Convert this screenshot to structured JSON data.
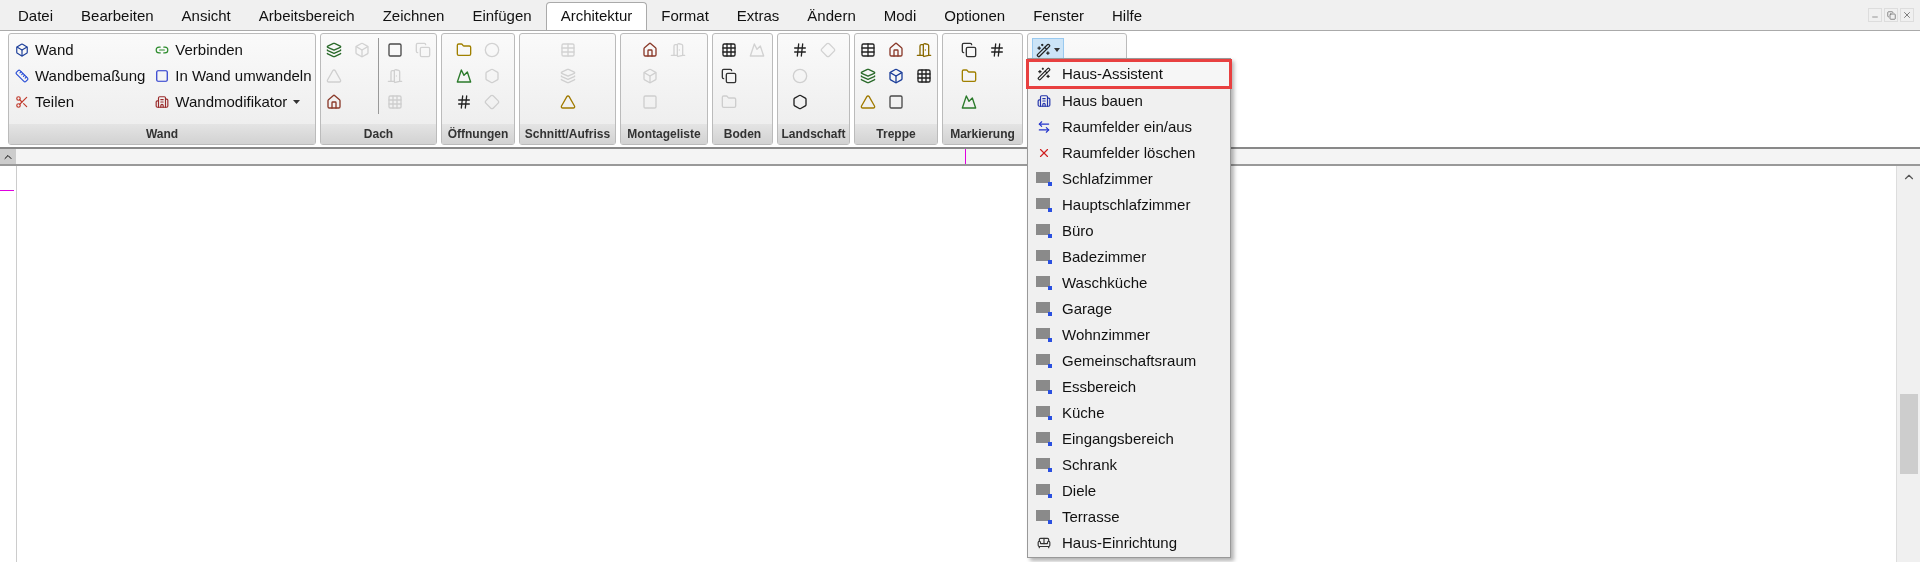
{
  "menu_bar": [
    {
      "label": "Datei",
      "selected": false
    },
    {
      "label": "Bearbeiten",
      "selected": false
    },
    {
      "label": "Ansicht",
      "selected": false
    },
    {
      "label": "Arbeitsbereich",
      "selected": false
    },
    {
      "label": "Zeichnen",
      "selected": false
    },
    {
      "label": "Einfügen",
      "selected": false
    },
    {
      "label": "Architektur",
      "selected": true
    },
    {
      "label": "Format",
      "selected": false
    },
    {
      "label": "Extras",
      "selected": false
    },
    {
      "label": "Ändern",
      "selected": false
    },
    {
      "label": "Modi",
      "selected": false
    },
    {
      "label": "Optionen",
      "selected": false
    },
    {
      "label": "Fenster",
      "selected": false
    },
    {
      "label": "Hilfe",
      "selected": false
    }
  ],
  "wall_group": {
    "label": "Wand",
    "columns": [
      [
        {
          "label": "Wand",
          "kind": "button"
        },
        {
          "label": "Wandbemaßung",
          "kind": "button"
        },
        {
          "label": "Teilen",
          "kind": "button"
        }
      ],
      [
        {
          "label": "Verbinden",
          "kind": "button"
        },
        {
          "label": "In Wand umwandeln",
          "kind": "button"
        },
        {
          "label": "Wandmodifikator",
          "kind": "dropdown"
        }
      ]
    ]
  },
  "groups": [
    {
      "label": "Dach",
      "columns": [
        {
          "buttons": [
            {
              "disabled": false
            },
            {
              "disabled": true
            },
            {
              "disabled": false
            }
          ]
        },
        {
          "buttons": [
            {
              "disabled": true
            }
          ],
          "separator": true
        },
        {
          "buttons": [
            {
              "disabled": false
            },
            {
              "disabled": true
            },
            {
              "disabled": true
            }
          ]
        },
        {
          "buttons": [
            {
              "disabled": true
            }
          ]
        }
      ]
    },
    {
      "label": "Öffnungen",
      "columns": [
        {
          "buttons": [
            {
              "disabled": false
            },
            {
              "disabled": false
            },
            {
              "disabled": false
            }
          ]
        },
        {
          "buttons": [
            {
              "disabled": true
            },
            {
              "disabled": true
            },
            {
              "disabled": true
            }
          ]
        }
      ]
    },
    {
      "label": "Schnitt/Aufriss",
      "columns": [
        {
          "buttons": [
            {
              "disabled": true
            },
            {
              "disabled": true
            },
            {
              "disabled": false
            }
          ]
        }
      ]
    },
    {
      "label": "Montageliste",
      "columns": [
        {
          "buttons": [
            {
              "disabled": false
            },
            {
              "disabled": true
            },
            {
              "disabled": true
            }
          ]
        },
        {
          "buttons": [
            {
              "disabled": true
            }
          ]
        }
      ]
    },
    {
      "label": "Boden",
      "columns": [
        {
          "buttons": [
            {
              "disabled": false
            },
            {
              "disabled": false
            },
            {
              "disabled": true
            }
          ]
        },
        {
          "buttons": [
            {
              "disabled": true
            }
          ]
        }
      ]
    },
    {
      "label": "Landschaft",
      "columns": [
        {
          "buttons": [
            {
              "disabled": false
            },
            {
              "disabled": true
            },
            {
              "disabled": false
            }
          ]
        },
        {
          "buttons": [
            {
              "disabled": true
            }
          ]
        }
      ]
    },
    {
      "label": "Treppe",
      "columns": [
        {
          "buttons": [
            {
              "disabled": false
            },
            {
              "disabled": false
            },
            {
              "disabled": false
            }
          ]
        },
        {
          "buttons": [
            {
              "disabled": false
            },
            {
              "disabled": false
            },
            {
              "disabled": false
            }
          ]
        },
        {
          "buttons": [
            {
              "disabled": false
            },
            {
              "disabled": false
            }
          ]
        }
      ]
    },
    {
      "label": "Markierung",
      "columns": [
        {
          "buttons": [
            {
              "disabled": false
            },
            {
              "disabled": false
            },
            {
              "disabled": false
            }
          ]
        },
        {
          "buttons": [
            {
              "disabled": false
            }
          ]
        }
      ]
    }
  ],
  "assistant_button": {
    "expanded": true
  },
  "dropdown_menu": [
    {
      "label": "Haus-Assistent",
      "selected": true
    },
    {
      "label": "Haus bauen",
      "selected": false
    },
    {
      "label": "Raumfelder ein/aus",
      "selected": false
    },
    {
      "label": "Raumfelder löschen",
      "selected": false
    },
    {
      "label": "Schlafzimmer",
      "selected": false
    },
    {
      "label": "Hauptschlafzimmer",
      "selected": false
    },
    {
      "label": "Büro",
      "selected": false
    },
    {
      "label": "Badezimmer",
      "selected": false
    },
    {
      "label": "Waschküche",
      "selected": false
    },
    {
      "label": "Garage",
      "selected": false
    },
    {
      "label": "Wohnzimmer",
      "selected": false
    },
    {
      "label": "Gemeinschaftsraum",
      "selected": false
    },
    {
      "label": "Essbereich",
      "selected": false
    },
    {
      "label": "Küche",
      "selected": false
    },
    {
      "label": "Eingangsbereich",
      "selected": false
    },
    {
      "label": "Schrank",
      "selected": false
    },
    {
      "label": "Diele",
      "selected": false
    },
    {
      "label": "Terrasse",
      "selected": false
    },
    {
      "label": "Haus-Einrichtung",
      "selected": false
    }
  ]
}
